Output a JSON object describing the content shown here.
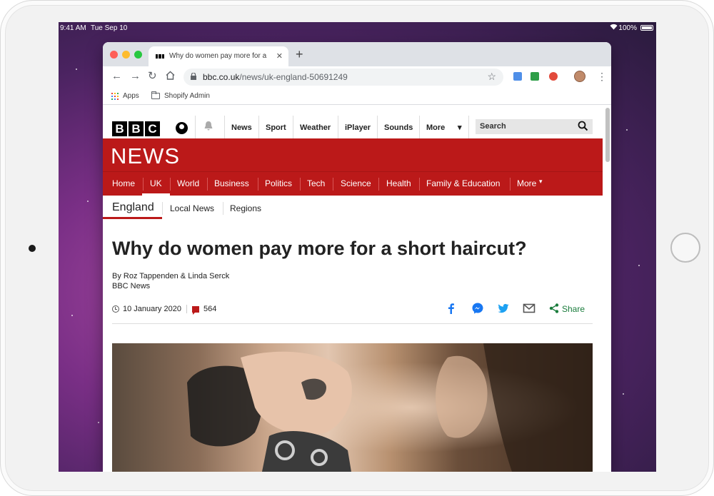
{
  "status_bar": {
    "time": "9:41 AM",
    "date": "Tue Sep 10",
    "battery": "100%"
  },
  "browser": {
    "tab_title": "Why do women pay more for a",
    "url_host": "bbc.co.uk",
    "url_path": "/news/uk-england-50691249",
    "bookmarks": [
      "Apps",
      "Shopify Admin"
    ]
  },
  "bbc": {
    "logo_letters": [
      "B",
      "B",
      "C"
    ],
    "top_nav": [
      "News",
      "Sport",
      "Weather",
      "iPlayer",
      "Sounds",
      "More"
    ],
    "search_placeholder": "Search",
    "section_title": "NEWS",
    "news_nav": [
      "Home",
      "UK",
      "World",
      "Business",
      "Politics",
      "Tech",
      "Science",
      "Health",
      "Family & Education",
      "More"
    ],
    "active_nav": "UK",
    "sub_nav": {
      "current": "England",
      "items": [
        "Local News",
        "Regions"
      ]
    }
  },
  "article": {
    "headline": "Why do women pay more for a short haircut?",
    "byline": "By Roz Tappenden & Linda Serck",
    "source": "BBC News",
    "date": "10 January 2020",
    "comments": "564",
    "share_label": "Share"
  },
  "colors": {
    "bbc_red": "#bb1919",
    "share_green": "#1a7c3c",
    "facebook": "#1877f2",
    "twitter": "#1da1f2"
  }
}
